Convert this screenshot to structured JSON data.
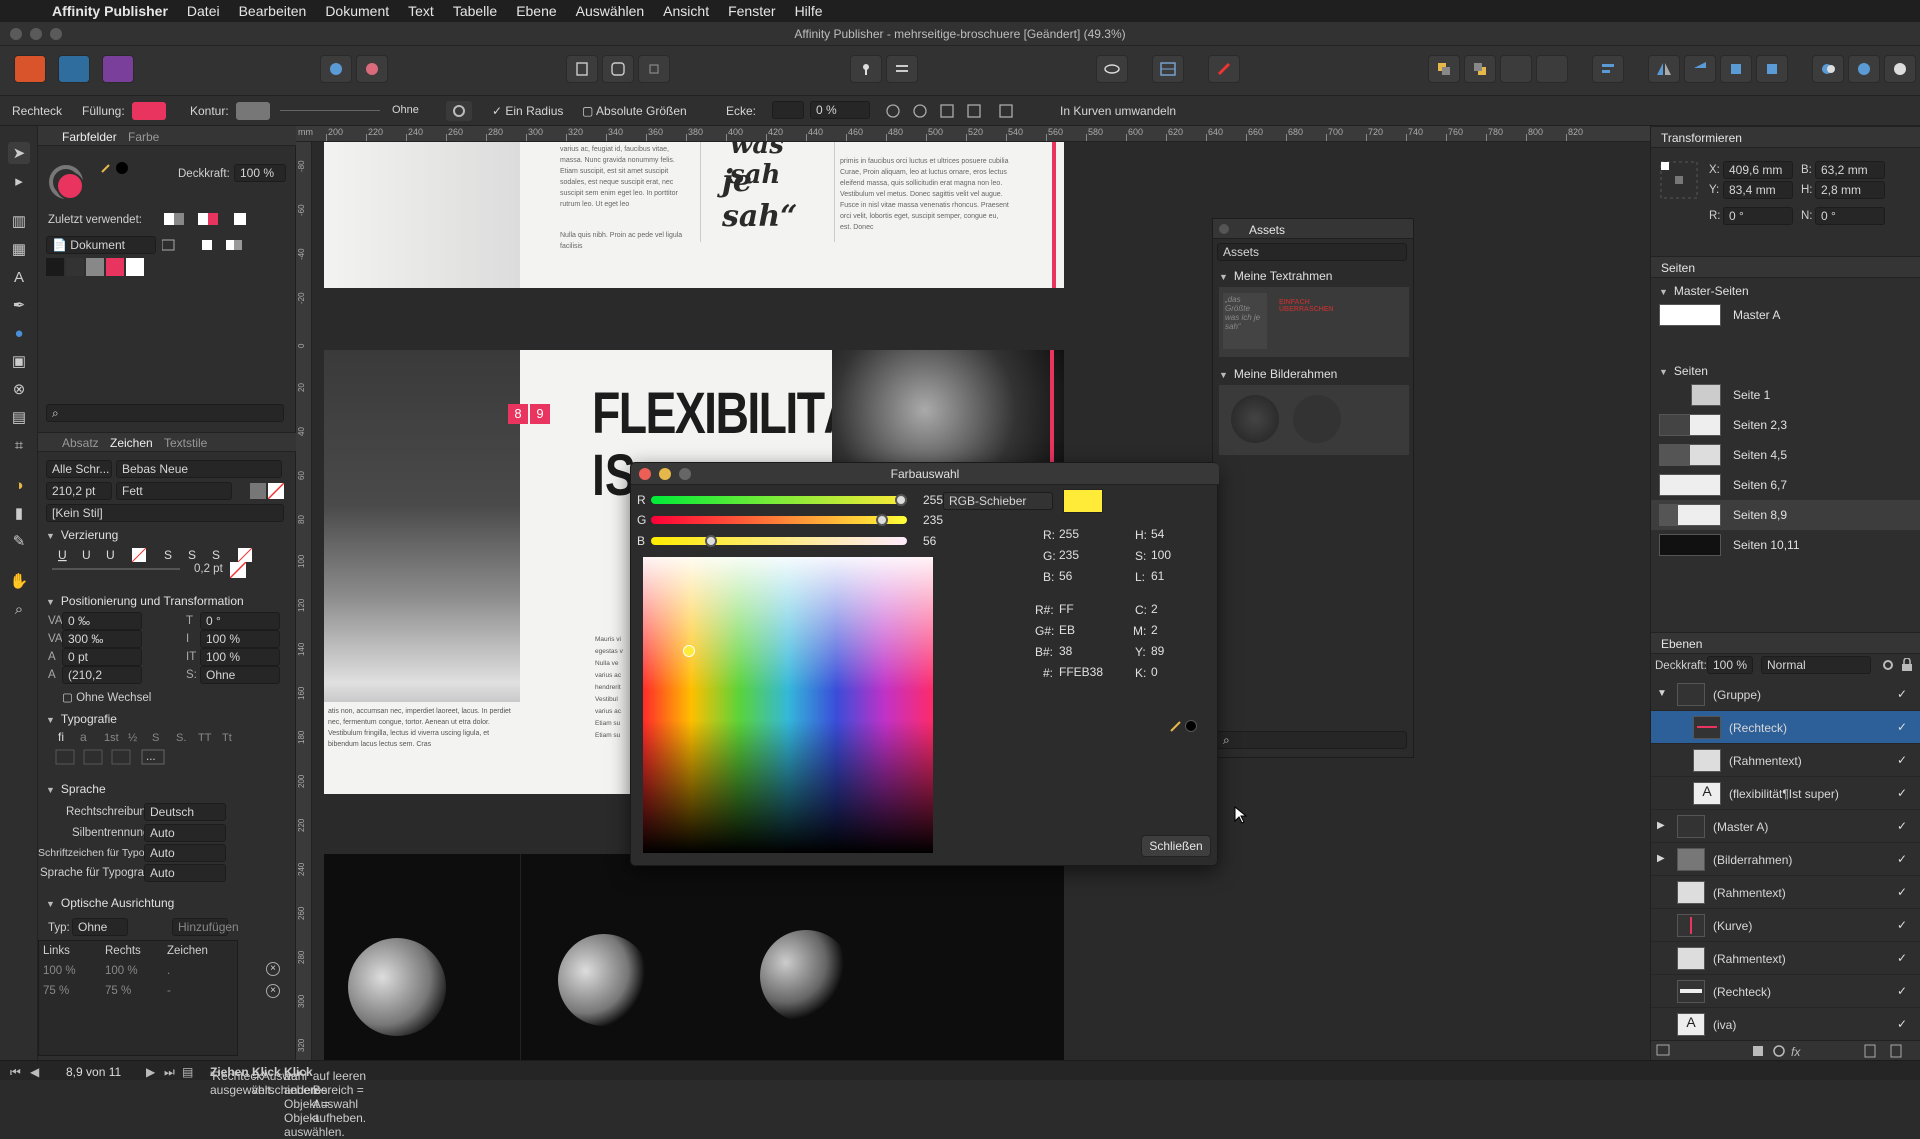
{
  "menubar": {
    "items": [
      "Affinity Publisher",
      "Datei",
      "Bearbeiten",
      "Dokument",
      "Text",
      "Tabelle",
      "Ebene",
      "Auswählen",
      "Ansicht",
      "Fenster",
      "Hilfe"
    ]
  },
  "window": {
    "title": "Affinity Publisher - mehrseitige-broschuere [Geändert] (49.3%)"
  },
  "context": {
    "tool": "Rechteck",
    "fill_label": "Füllung:",
    "fill_color": "#e8345f",
    "stroke_label": "Kontur:",
    "stroke_none": "Ohne",
    "one_radius": "Ein Radius",
    "absolute_sizes": "Absolute Größen",
    "corner_label": "Ecke:",
    "corner_value": "0 %",
    "convert": "In Kurven umwandeln"
  },
  "left_panel": {
    "tabs": [
      "Farbfelder",
      "Farbe"
    ],
    "opacity_label": "Deckkraft:",
    "opacity_value": "100 %",
    "recent_label": "Zuletzt verwendet:",
    "document_select": "Dokument",
    "char_tabs": [
      "Absatz",
      "Zeichen",
      "Textstile"
    ],
    "font_collection": "Alle Schr...",
    "font_family": "Bebas Neue",
    "font_size": "210,2 pt",
    "font_style": "Fett",
    "char_style": "[Kein Stil]",
    "sections": {
      "decoration": "Verzierung",
      "positioning": "Positionierung und Transformation",
      "typography": "Typografie",
      "language": "Sprache",
      "optical": "Optische Ausrichtung"
    },
    "stroke_weight": "0,2 pt",
    "pos_values": {
      "tracking": "0 ‰",
      "leading": "300 ‰",
      "baseline": "0 pt",
      "size2": "(210,2",
      "skew": "0 °",
      "vscale": "100 %",
      "hscale": "100 %",
      "shear": "Ohne",
      "shear_label": "S:"
    },
    "no_change": "Ohne Wechsel",
    "typo_more": "...",
    "lang": {
      "spelling_label": "Rechtschreibung:",
      "spelling_value": "Deutsch",
      "hyphen_label": "Silbentrennung:",
      "hyphen_value": "Auto",
      "glyph_label": "Schriftzeichen für Typografie:",
      "glyph_value": "Auto",
      "typolang_label": "Sprache für Typografie:",
      "typolang_value": "Auto"
    },
    "optical": {
      "type_label": "Typ:",
      "type_value": "Ohne",
      "add_button": "Hinzufügen",
      "columns": [
        "Links",
        "Rechts",
        "Zeichen"
      ],
      "rows": [
        [
          "100 %",
          "100 %",
          "."
        ],
        [
          "75 %",
          "75 %",
          "-"
        ]
      ]
    }
  },
  "ruler": {
    "top_labels": [
      "200",
      "220",
      "240",
      "260",
      "280",
      "300",
      "320",
      "340",
      "360",
      "380",
      "400",
      "420",
      "440",
      "460",
      "480",
      "500",
      "520",
      "540",
      "560",
      "580",
      "600",
      "620",
      "640",
      "660",
      "680",
      "700",
      "720",
      "740",
      "760",
      "780",
      "800",
      "820"
    ],
    "unit": "mm",
    "left_labels": [
      "-80",
      "-60",
      "-40",
      "-20",
      "0",
      "20",
      "40",
      "60",
      "80",
      "100",
      "120",
      "140",
      "160",
      "180",
      "200",
      "220",
      "240",
      "260",
      "280",
      "300",
      "320"
    ]
  },
  "canvas": {
    "headline_1": "FLEXIBILITÄT",
    "headline_2": "IS",
    "page_num_left": "8",
    "page_num_right": "9",
    "quote_1": "was sah",
    "quote_2": "je sah“",
    "body_top": "varius ac, feugiat id, faucibus vitae, massa. Nunc gravida nonummy felis. Etiam suscipit, est sit amet suscipit sodales, est neque suscipit erat, nec suscipit sem enim eget leo. In porttitor rutrum leo. Ut eget leo",
    "body_top_2": "Nulla quis nibh. Proin ac pede vel ligula facilisis",
    "body_right": "primis in faucibus orci luctus et ultrices posuere cubilia Curae, Proin aliquam, leo at luctus ornare, eros lectus eleifend massa, quis sollicitudin erat magna non leo. Vestibulum vel metus. Donec sagittis velit vel augue. Fusce in nisl vitae massa venenatis rhoncus. Praesent orci velit, lobortis eget, suscipit semper, congue eu, est. Donec",
    "body_mid": "Mauris vi egestas v Nulla ve varius ac hendrerit Vestibul varius ac Etiam su Etiam su",
    "body_left": "atis non, accumsan nec, imperdiet laoreet, lacus. In perdiet nec, fermentum congue, tortor. Aenean ut etra dolor. Vestibulum fringilla, lectus id viverra uscing ligula, et bibendum lacus lectus sem. Cras"
  },
  "assets": {
    "title": "Assets",
    "select": "Assets",
    "group1": "Meine Textrahmen",
    "group2": "Meine Bilderahmen"
  },
  "color_dialog": {
    "title": "Farbauswahl",
    "mode": "RGB-Schieber",
    "swatch": "#ffeb38",
    "r_label": "R",
    "g_label": "G",
    "b_label": "B",
    "r": 255,
    "g": 235,
    "b": 56,
    "r_text": "255",
    "g_text": "235",
    "b_text": "56",
    "fields": {
      "R": "255",
      "G": "235",
      "B": "56",
      "H": "54",
      "S": "100",
      "L": "61",
      "R#": "FF",
      "G#": "EB",
      "B#": "38",
      "C": "2",
      "M": "2",
      "Y": "89",
      "K": "0",
      "hex": "FFEB38"
    },
    "labels": {
      "R": "R:",
      "G": "G:",
      "B": "B:",
      "H": "H:",
      "S": "S:",
      "L": "L:",
      "Rh": "R#:",
      "Gh": "G#:",
      "Bh": "B#:",
      "C": "C:",
      "M": "M:",
      "Y": "Y:",
      "K": "K:",
      "hex": "#:"
    },
    "close": "Schließen"
  },
  "transform": {
    "title": "Transformieren",
    "x_label": "X:",
    "x": "409,6 mm",
    "y_label": "Y:",
    "y": "83,4 mm",
    "b_label": "B:",
    "b": "63,2 mm",
    "h_label": "H:",
    "h": "2,8 mm",
    "r_label": "R:",
    "r": "0 °",
    "n_label": "N:",
    "n": "0 °"
  },
  "pages": {
    "title": "Seiten",
    "masters_label": "Master-Seiten",
    "master_a": "Master A",
    "pages_label": "Seiten",
    "items": [
      "Seite 1",
      "Seiten 2,3",
      "Seiten 4,5",
      "Seiten 6,7",
      "Seiten 8,9",
      "Seiten 10,11"
    ]
  },
  "layers": {
    "title": "Ebenen",
    "opacity_label": "Deckkraft:",
    "opacity_value": "100 %",
    "blend": "Normal",
    "items": [
      "(Gruppe)",
      "(Rechteck)",
      "(Rahmentext)",
      "(flexibilität¶Ist super)",
      "(Master A)",
      "(Bilderrahmen)",
      "(Rahmentext)",
      "(Kurve)",
      "(Rahmentext)",
      "(Rechteck)",
      "(iva)"
    ]
  },
  "status": {
    "page": "8,9 von 11",
    "msg_1": "'Rechteck' ausgewählt.",
    "msg_2": "Ziehen",
    "msg_3": "= Auswahl verschieben.",
    "msg_4": "Klick",
    "msg_5": "auf anderes Objekt = Objekt auswählen.",
    "msg_6": "Klick",
    "msg_7": "auf leeren Bereich = Auswahl aufheben."
  }
}
